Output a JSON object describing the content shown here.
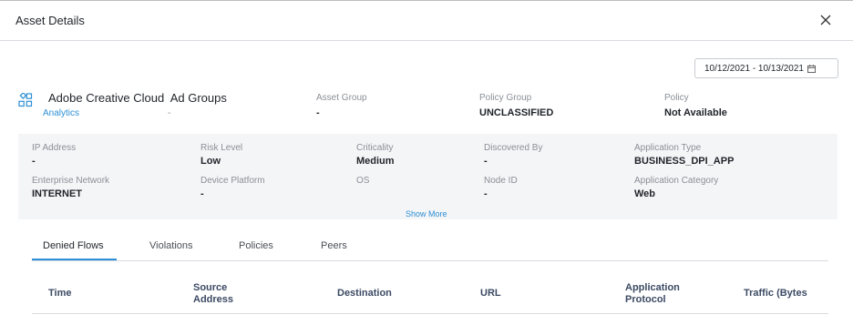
{
  "dialog": {
    "title": "Asset Details",
    "close_icon": "close-icon"
  },
  "date_range": {
    "value": "10/12/2021 - 10/13/2021",
    "icon": "calendar-icon"
  },
  "asset": {
    "icon": "asset-grid-icon",
    "name": "Adobe Creative Cloud  Ad Groups",
    "category_link": "Analytics",
    "secondary": "-"
  },
  "summary": [
    {
      "label": "Asset Group",
      "value": "-"
    },
    {
      "label": "Policy Group",
      "value": "UNCLASSIFIED"
    },
    {
      "label": "Policy",
      "value": "Not Available"
    }
  ],
  "details": [
    {
      "label": "IP Address",
      "value": "-"
    },
    {
      "label": "Risk Level",
      "value": "Low"
    },
    {
      "label": "Criticality",
      "value": "Medium"
    },
    {
      "label": "Discovered By",
      "value": "-"
    },
    {
      "label": "Application Type",
      "value": "BUSINESS_DPI_APP"
    },
    {
      "label": "Enterprise Network",
      "value": "INTERNET"
    },
    {
      "label": "Device Platform",
      "value": "-"
    },
    {
      "label": "OS",
      "value": ""
    },
    {
      "label": "Node ID",
      "value": "-"
    },
    {
      "label": "Application Category",
      "value": "Web"
    }
  ],
  "show_more": "Show More",
  "tabs": [
    {
      "label": "Denied Flows",
      "active": true
    },
    {
      "label": "Violations",
      "active": false
    },
    {
      "label": "Policies",
      "active": false
    },
    {
      "label": "Peers",
      "active": false
    }
  ],
  "table": {
    "columns": [
      {
        "line1": "Time",
        "line2": ""
      },
      {
        "line1": "Source",
        "line2": "Address"
      },
      {
        "line1": "Destination",
        "line2": ""
      },
      {
        "line1": "URL",
        "line2": ""
      },
      {
        "line1": "Application",
        "line2": "Protocol"
      },
      {
        "line1": "Traffic (Bytes",
        "line2": ""
      }
    ]
  },
  "colors": {
    "accent": "#2d8fd5",
    "header_text": "#3b4a63",
    "panel_bg": "#f4f5f7"
  }
}
